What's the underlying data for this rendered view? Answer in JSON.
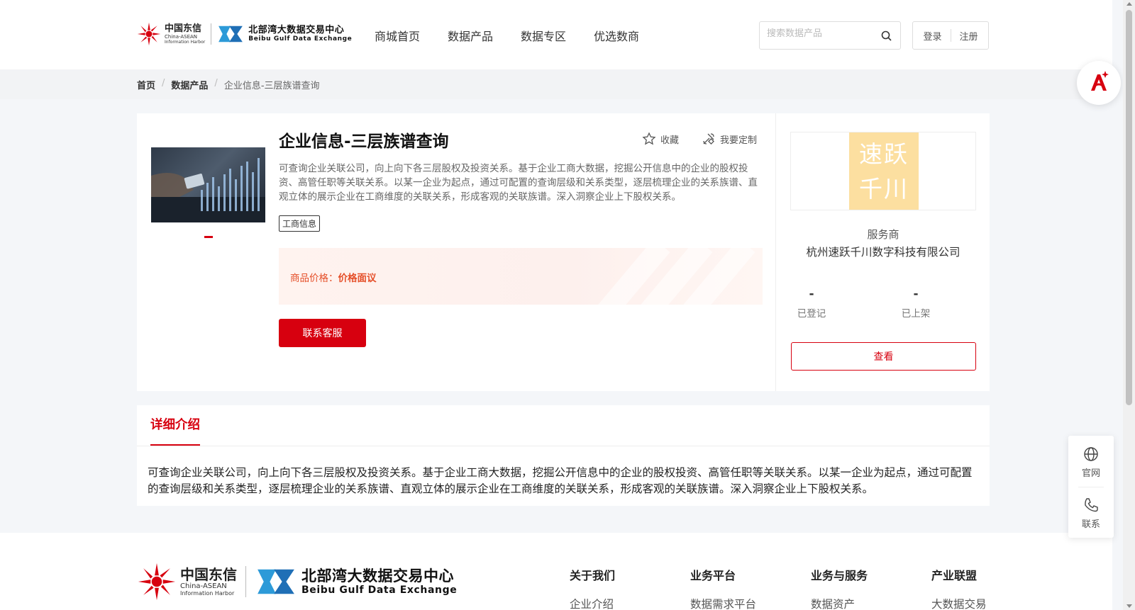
{
  "header": {
    "logo_ct_cn": "中国东信",
    "logo_ct_en1": "China-ASEAN",
    "logo_ct_en2": "Information Harbor",
    "logo_bx_cn": "北部湾大数据交易中心",
    "logo_bx_en": "Beibu Gulf Data Exchange",
    "nav": [
      "商城首页",
      "数据产品",
      "数据专区",
      "优选数商"
    ],
    "search_placeholder": "搜索数据产品",
    "login": "登录",
    "register": "注册"
  },
  "breadcrumb": [
    "首页",
    "数据产品",
    "企业信息-三层族谱查询"
  ],
  "product": {
    "title": "企业信息-三层族谱查询",
    "favorite": "收藏",
    "customize": "我要定制",
    "description": "可查询企业关联公司，向上向下各三层股权及投资关系。基于企业工商大数据，挖掘公开信息中的企业的股权投资、高管任职等关联关系。以某一企业为起点，通过可配置的查询层级和关系类型，逐层梳理企业的关系族谱、直观立体的展示企业在工商维度的关联关系，形成客观的关联族谱。深入洞察企业上下股权关系。",
    "tag": "工商信息",
    "price_label": "商品价格：",
    "price_value": "价格面议",
    "contact_button": "联系客服"
  },
  "provider": {
    "logo_line1": "速跃",
    "logo_line2": "千川",
    "role": "服务商",
    "name": "杭州速跃千川数字科技有限公司",
    "stats": [
      {
        "value": "-",
        "label": "已登记"
      },
      {
        "value": "-",
        "label": "已上架"
      }
    ],
    "view_button": "查看"
  },
  "detail": {
    "tab": "详细介绍",
    "text": "可查询企业关联公司，向上向下各三层股权及投资关系。基于企业工商大数据，挖掘公开信息中的企业的股权投资、高管任职等关联关系。以某一企业为起点，通过可配置的查询层级和关系类型，逐层梳理企业的关系族谱、直观立体的展示企业在工商维度的关联关系，形成客观的关联族谱。深入洞察企业上下股权关系。"
  },
  "footer": {
    "columns": [
      {
        "heading": "关于我们",
        "item": "企业介绍"
      },
      {
        "heading": "业务平台",
        "item": "数据需求平台"
      },
      {
        "heading": "业务与服务",
        "item": "数据资产"
      },
      {
        "heading": "产业联盟",
        "item": "大数据交易"
      }
    ]
  },
  "float": {
    "website": "官网",
    "contact": "联系"
  },
  "colors": {
    "brand_red": "#d7000f",
    "price_orange": "#e5502a",
    "provider_logo_bg": "#fcdfa0"
  }
}
